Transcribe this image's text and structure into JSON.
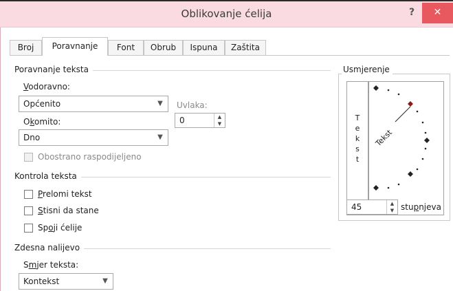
{
  "window": {
    "title": "Oblikovanje ćelija",
    "help_label": "?",
    "close_label": "✕"
  },
  "tabs": [
    {
      "label": "Broj",
      "active": false
    },
    {
      "label": "Poravnanje",
      "active": true
    },
    {
      "label": "Font",
      "active": false
    },
    {
      "label": "Obrub",
      "active": false
    },
    {
      "label": "Ispuna",
      "active": false
    },
    {
      "label": "Zaštita",
      "active": false
    }
  ],
  "alignment": {
    "group_title": "Poravnanje teksta",
    "horizontal": {
      "label_underlined": "V",
      "label_rest": "odoravno:",
      "value": "Općenito"
    },
    "vertical": {
      "label_pre": "O",
      "label_underlined": "k",
      "label_rest": "omito:",
      "value": "Dno"
    },
    "indent": {
      "label": "Uvlaka:",
      "value": "0"
    },
    "distributed": {
      "label": "Obostrano raspodijeljeno",
      "checked": false,
      "enabled": false
    }
  },
  "text_control": {
    "group_title": "Kontrola teksta",
    "wrap": {
      "label_underlined": "P",
      "label_rest": "relomi tekst",
      "checked": false
    },
    "shrink": {
      "label_underlined": "S",
      "label_rest": "tisni da stane",
      "checked": false
    },
    "merge": {
      "label_pre": "Sp",
      "label_underlined": "o",
      "label_rest": "ji ćelije",
      "checked": false
    }
  },
  "rtl": {
    "group_title": "Zdesna nalijevo",
    "direction": {
      "label_pre": "S",
      "label_underlined": "m",
      "label_rest": "jer teksta:",
      "value": "Kontekst"
    }
  },
  "orientation": {
    "group_title": "Usmjerenje",
    "vertical_text": [
      "T",
      "e",
      "k",
      "s",
      "t"
    ],
    "dial_text": "Tekst",
    "degrees_value": "45",
    "degrees_label_pre": "stu",
    "degrees_label_underlined": "p",
    "degrees_label_rest": "njeva",
    "angle_degrees": 45,
    "marker_color": "#8b1a1a"
  },
  "icons": {
    "dropdown": "chevron-down-icon",
    "spin": "spin-up-down-icon"
  }
}
